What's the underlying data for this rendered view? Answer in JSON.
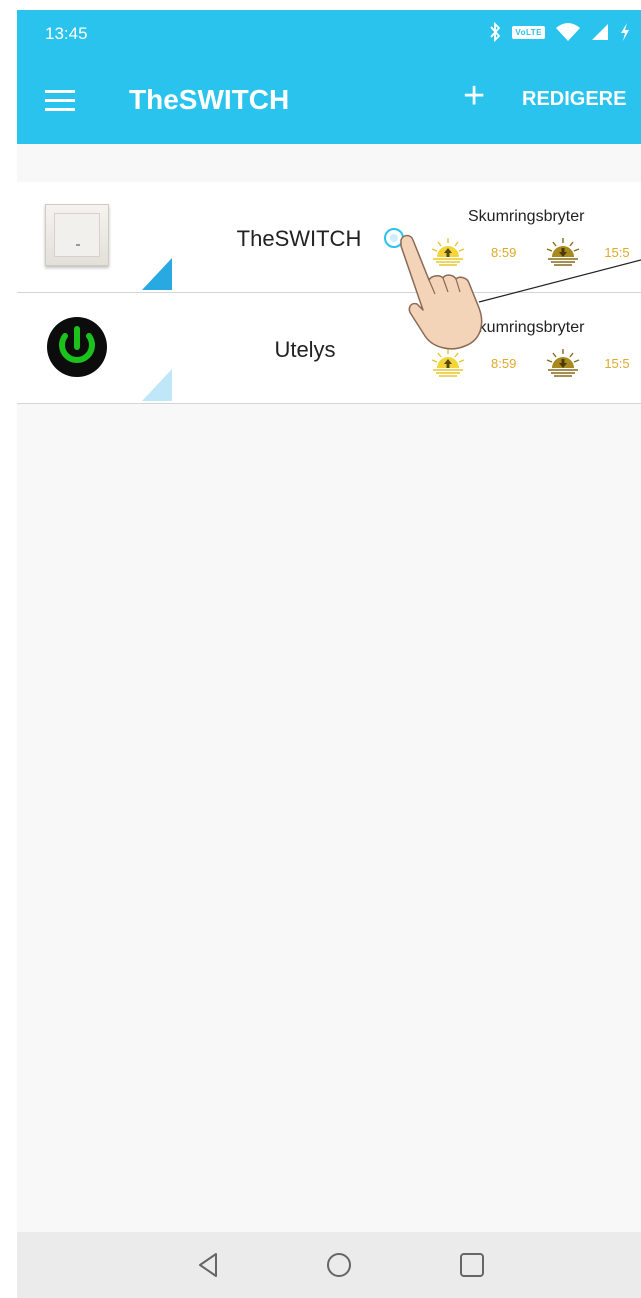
{
  "status_bar": {
    "time": "13:45",
    "volte": "VoLTE",
    "icons": [
      "bluetooth-icon",
      "volte-icon",
      "wifi-icon",
      "signal-icon",
      "charging-icon"
    ]
  },
  "app_bar": {
    "title": "TheSWITCH",
    "add_label": "+",
    "edit_label": "REDIGERE"
  },
  "devices": [
    {
      "name": "TheSWITCH",
      "icon": "wall-switch-icon",
      "mode": "Skumringsbryter",
      "sunrise_time": "8:59",
      "sunset_time": "15:5",
      "active": true
    },
    {
      "name": "Utelys",
      "icon": "power-icon",
      "mode": "Skumringsbryter",
      "sunrise_time": "8:59",
      "sunset_time": "15:5",
      "active": false
    }
  ],
  "colors": {
    "accent": "#29c3ee",
    "time_text": "#e0a92a",
    "power_green": "#1bc21b"
  },
  "nav_bar": [
    "back-icon",
    "home-icon",
    "recents-icon"
  ]
}
